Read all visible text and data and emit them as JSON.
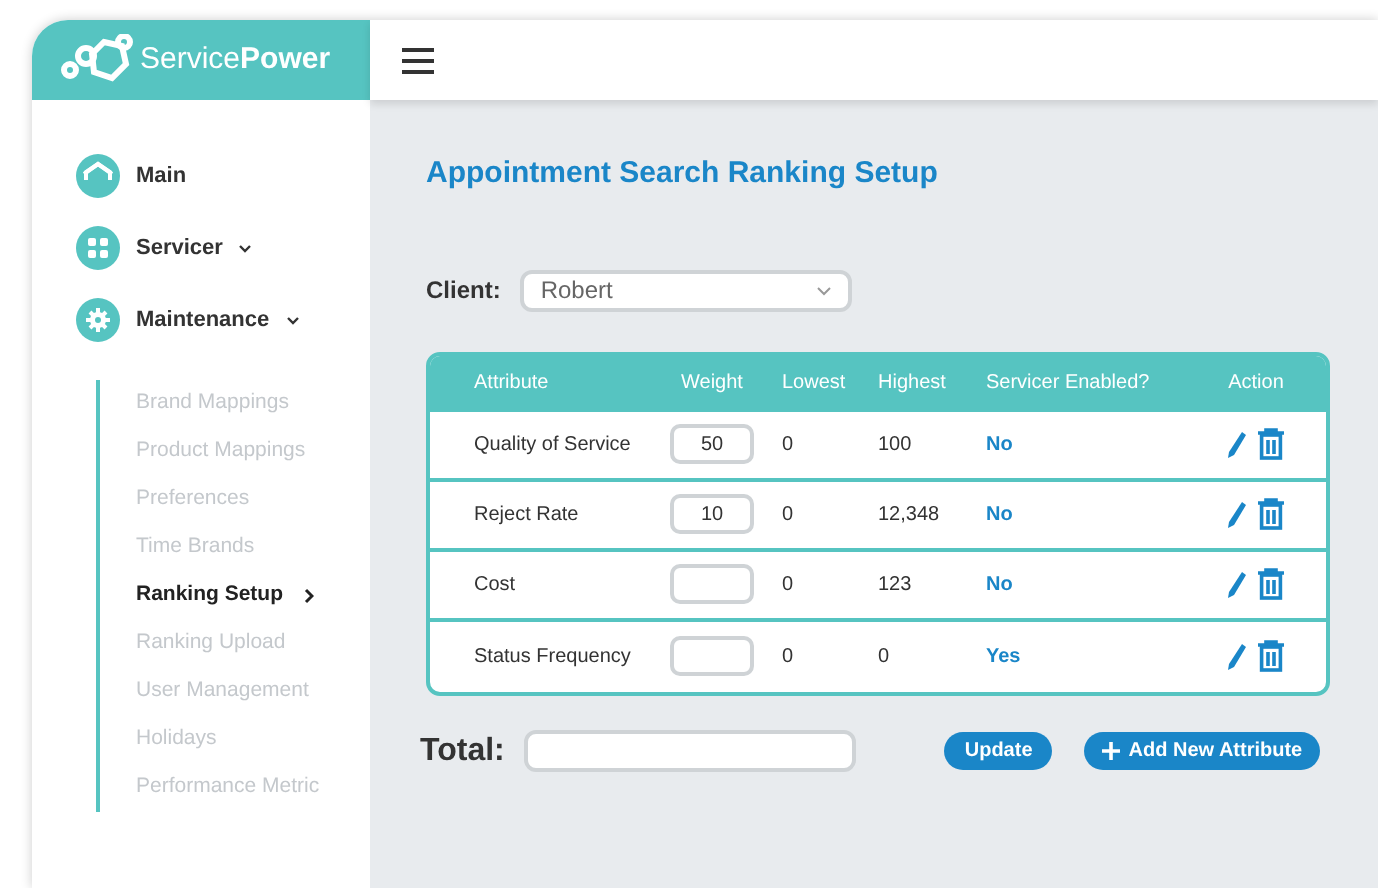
{
  "logo": {
    "text": "Service**Power**"
  },
  "sidebar": {
    "items": [
      {
        "label": "Main",
        "expandable": false
      },
      {
        "label": "Servicer",
        "expandable": true
      },
      {
        "label": "Maintenance",
        "expandable": true,
        "children": [
          {
            "label": "Brand Mappings",
            "selected": false
          },
          {
            "label": "Product Mappings",
            "selected": false
          },
          {
            "label": "Preferences",
            "selected": false
          },
          {
            "label": "Time Brands",
            "selected": false
          },
          {
            "label": "Ranking Setup",
            "selected": true
          },
          {
            "label": "Ranking Upload",
            "selected": false
          },
          {
            "label": "User Management",
            "selected": false
          },
          {
            "label": "Holidays",
            "selected": false
          },
          {
            "label": "Performance Metric",
            "selected": false
          }
        ]
      }
    ]
  },
  "page_title": "Appointment Search Ranking Setup",
  "client": {
    "label": "Client:",
    "value": "Robert"
  },
  "table": {
    "columns": [
      "Attribute",
      "Weight",
      "Lowest",
      "Highest",
      "Servicer Enabled?",
      "Action"
    ],
    "rows": [
      {
        "attribute": "Quality of Service",
        "weight": "50",
        "lowest": "0",
        "highest": "100",
        "enabled": "No"
      },
      {
        "attribute": "Reject Rate",
        "weight": "10",
        "lowest": "0",
        "highest": "12,348",
        "enabled": "No"
      },
      {
        "attribute": "Cost",
        "lowest": "0",
        "highest": "123",
        "enabled": "No"
      },
      {
        "attribute": "Status Frequency",
        "lowest": "0",
        "highest": "0",
        "enabled": "Yes"
      }
    ]
  },
  "total": {
    "label": "Total:"
  },
  "buttons": [
    {
      "label": "Update",
      "kind": "plain"
    },
    {
      "label": "Add New Attribute",
      "kind": "add"
    }
  ]
}
